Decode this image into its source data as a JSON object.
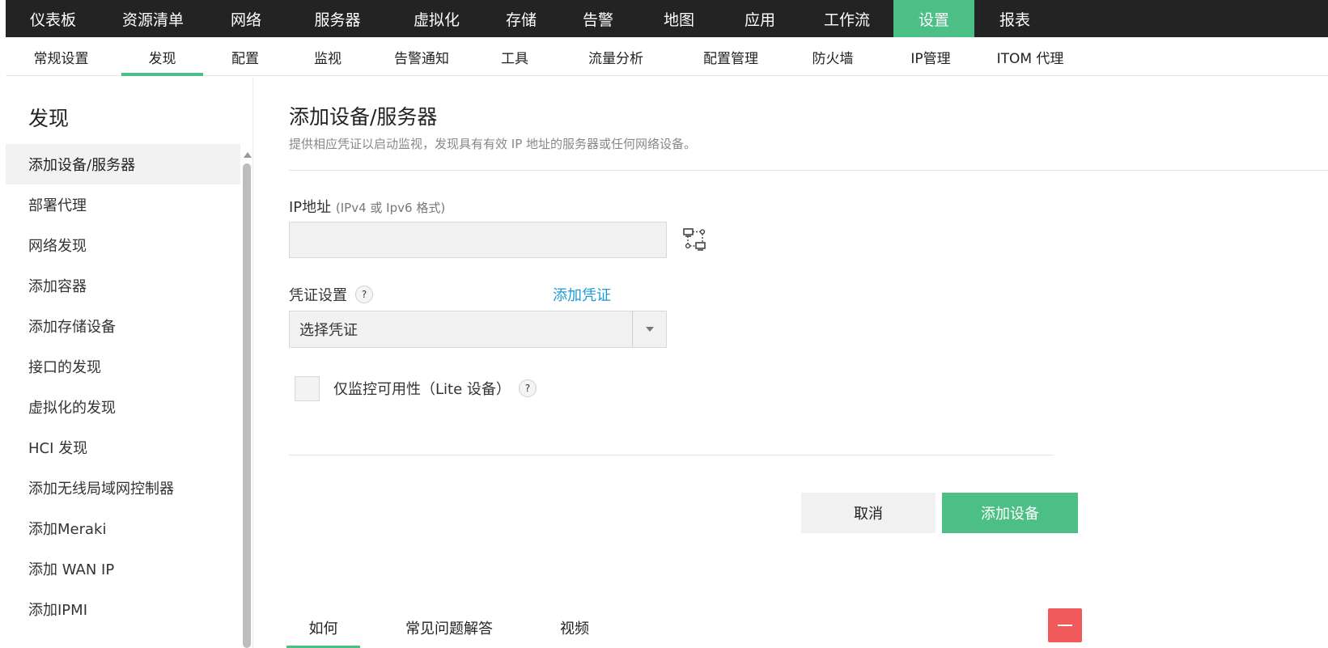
{
  "topnav": {
    "items": [
      "仪表板",
      "资源清单",
      "网络",
      "服务器",
      "虚拟化",
      "存储",
      "告警",
      "地图",
      "应用",
      "工作流",
      "设置",
      "报表"
    ],
    "active": "设置",
    "active_color": "#4bbf85"
  },
  "subnav": {
    "items": [
      "常规设置",
      "发现",
      "配置",
      "监视",
      "告警通知",
      "工具",
      "流量分析",
      "配置管理",
      "防火墙",
      "IP管理",
      "ITOM 代理"
    ],
    "active": "发现"
  },
  "sidebar": {
    "title": "发现",
    "items": [
      "添加设备/服务器",
      "部署代理",
      "网络发现",
      "添加容器",
      "添加存储设备",
      "接口的发现",
      "虚拟化的发现",
      "HCI 发现",
      "添加无线局域网控制器",
      "添加Meraki",
      "添加 WAN IP",
      "添加IPMI"
    ],
    "active": "添加设备/服务器"
  },
  "main": {
    "title": "添加设备/服务器",
    "description": "提供相应凭证以启动监视，发现具有有效 IP 地址的服务器或任何网络设备。",
    "ip_label": "IP地址",
    "ip_hint": "(IPv4 或 Ipv6 格式)",
    "ip_value": "",
    "ip_range_icon": "ip-range-icon",
    "credential_label": "凭证设置",
    "help_glyph": "?",
    "add_credential_link": "添加凭证",
    "credential_select_value": "选择凭证",
    "lite_label": "仅监控可用性（Lite 设备）",
    "lite_checked": false,
    "cancel_label": "取消",
    "add_device_label": "添加设备",
    "bottom_tabs": [
      "如何",
      "常见问题解答",
      "视频"
    ],
    "bottom_tab_active": "如何",
    "collapse_color": "#f05a5a"
  }
}
